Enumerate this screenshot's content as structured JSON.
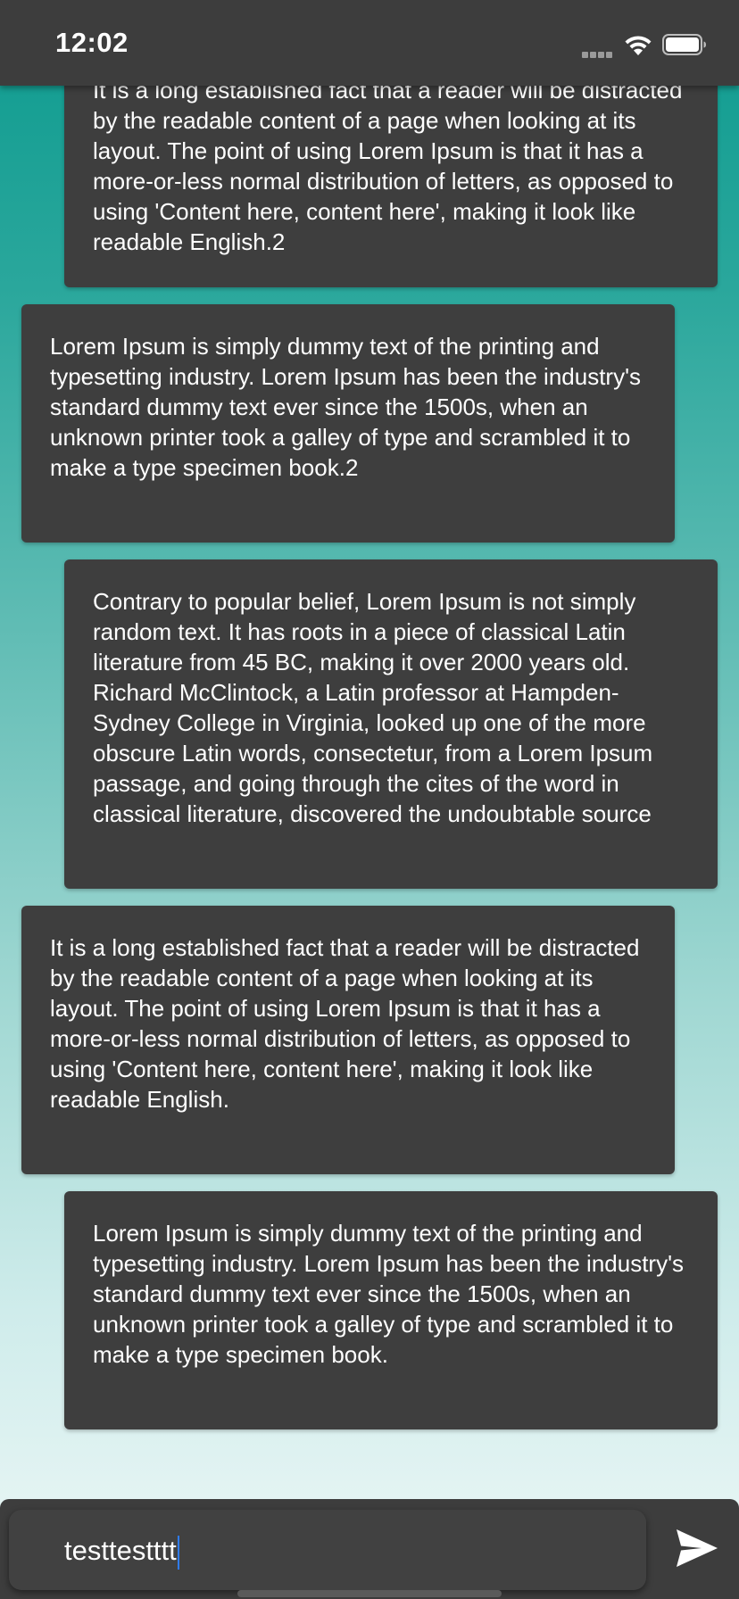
{
  "status_bar": {
    "time": "12:02",
    "icons": [
      "cellular-signal-icon",
      "wifi-icon",
      "battery-icon"
    ]
  },
  "messages": [
    {
      "side": "right",
      "text": "It is a long established fact that a reader will be distracted by the readable content of a page when looking at its layout. The point of using Lorem Ipsum is that it has a more-or-less normal distribution of letters, as opposed to using 'Content here, content here', making it look like readable English.2"
    },
    {
      "side": "left",
      "text": "Lorem Ipsum is simply dummy text of the printing and typesetting industry. Lorem Ipsum has been the industry's standard dummy text ever since the 1500s, when an unknown printer took a galley of type and scrambled it to make a type specimen book.2"
    },
    {
      "side": "right",
      "text": "Contrary to popular belief, Lorem Ipsum is not simply random text. It has roots in a piece of classical Latin literature from 45 BC, making it over 2000 years old. Richard McClintock, a Latin professor at Hampden-Sydney College in Virginia, looked up one of the more obscure Latin words, consectetur, from a Lorem Ipsum passage, and going through the cites of the word in classical literature, discovered the undoubtable source"
    },
    {
      "side": "left",
      "text": "It is a long established fact that a reader will be distracted by the readable content of a page when looking at its layout. The point of using Lorem Ipsum is that it has a more-or-less normal distribution of letters, as opposed to using 'Content here, content here', making it look like readable English."
    },
    {
      "side": "right",
      "text": "Lorem Ipsum is simply dummy text of the printing and typesetting industry. Lorem Ipsum has been the industry's standard dummy text ever since the 1500s, when an unknown printer took a galley of type and scrambled it to make a type specimen book."
    }
  ],
  "composer": {
    "input_value": "testtestttt",
    "send_icon": "send-icon"
  },
  "colors": {
    "bubble_bg": "#3e3e3e",
    "bar_bg": "#3d3d3d",
    "gradient_top": "#0d9b8f",
    "gradient_bottom": "#eef8f7",
    "caret": "#2f7cf6"
  }
}
